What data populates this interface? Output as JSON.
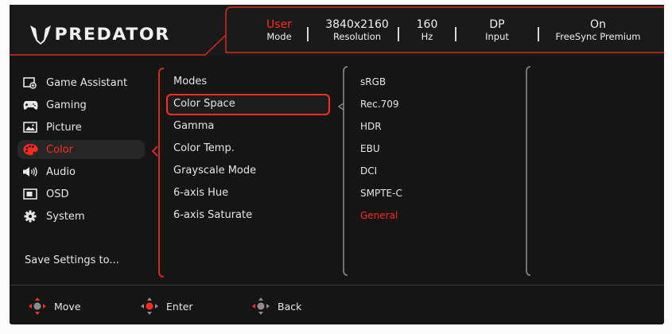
{
  "brand": {
    "logo_text": "PREDATOR"
  },
  "header": {
    "stats": [
      {
        "value": "User",
        "label": "Mode"
      },
      {
        "value": "3840x2160",
        "label": "Resolution"
      },
      {
        "value": "160",
        "label": "Hz"
      },
      {
        "value": "DP",
        "label": "Input"
      },
      {
        "value": "On",
        "label": "FreeSync Premium"
      }
    ]
  },
  "menu": {
    "items": [
      {
        "label": "Game Assistant",
        "icon": "game-assistant-icon"
      },
      {
        "label": "Gaming",
        "icon": "gamepad-icon"
      },
      {
        "label": "Picture",
        "icon": "picture-icon"
      },
      {
        "label": "Color",
        "icon": "palette-icon",
        "active": true
      },
      {
        "label": "Audio",
        "icon": "speaker-icon"
      },
      {
        "label": "OSD",
        "icon": "osd-icon"
      },
      {
        "label": "System",
        "icon": "gear-icon"
      }
    ],
    "save_label": "Save Settings to..."
  },
  "submenu": {
    "items": [
      "Modes",
      "Color Space",
      "Gamma",
      "Color Temp.",
      "Grayscale Mode",
      "6-axis Hue",
      "6-axis Saturate"
    ],
    "selected": "Color Space"
  },
  "options": {
    "items": [
      "sRGB",
      "Rec.709",
      "HDR",
      "EBU",
      "DCI",
      "SMPTE-C",
      "General"
    ],
    "current": "General"
  },
  "footer": {
    "hints": [
      {
        "label": "Move"
      },
      {
        "label": "Enter"
      },
      {
        "label": "Back"
      }
    ]
  },
  "colors": {
    "accent": "#ff2b1c",
    "background": "#151515",
    "text": "#e6e6e6"
  }
}
